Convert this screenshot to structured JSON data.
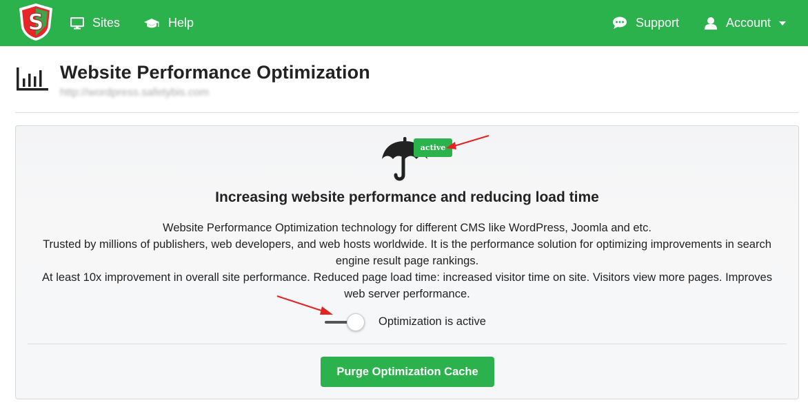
{
  "nav": {
    "sites_label": "Sites",
    "help_label": "Help",
    "support_label": "Support",
    "account_label": "Account"
  },
  "header": {
    "title": "Website Performance Optimization",
    "url": "http://wordpress.safetybis.com"
  },
  "panel": {
    "badge": "active",
    "title": "Increasing website performance and reducing load time",
    "description_lines": [
      "Website Performance Optimization technology for different CMS like WordPress, Joomla and etc.",
      "Trusted by millions of publishers, web developers, and web hosts worldwide. It is the performance solution for optimizing improvements in search engine result page rankings.",
      "At least 10x improvement in overall site performance. Reduced page load time: increased visitor time on site. Visitors view more pages. Improves web server performance."
    ],
    "toggle_label": "Optimization is active",
    "toggle_on": true,
    "purge_button": "Purge Optimization Cache"
  },
  "icons": {
    "logo": "shield-s-logo",
    "sites": "monitor-icon",
    "help": "graduation-cap-icon",
    "support": "chat-bubble-icon",
    "account": "user-icon",
    "header": "bar-chart-icon",
    "hero": "umbrella-icon"
  },
  "colors": {
    "brand_green": "#2bb24c",
    "logo_red": "#e8262a",
    "annotation_red": "#e32222"
  }
}
